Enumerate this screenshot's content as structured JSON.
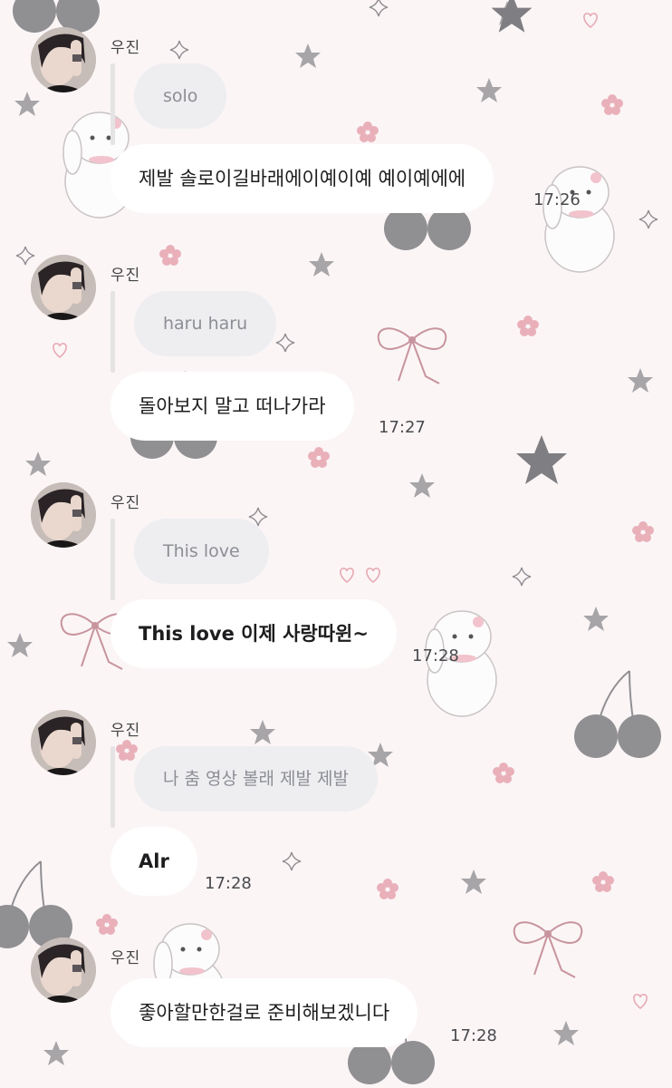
{
  "chat": {
    "messages": [
      {
        "sender": "우진",
        "quote": "solo",
        "text": "제발 솔로이길바래에이예이예 예이예에에",
        "time": "17:26"
      },
      {
        "sender": "우진",
        "quote": "haru haru",
        "text": "돌아보지 말고 떠나가라",
        "time": "17:27"
      },
      {
        "sender": "우진",
        "quote": "This love",
        "text": "This love 이제 사랑따윈~",
        "time": "17:28"
      },
      {
        "sender": "우진",
        "quote": "나 춤 영상 볼래 제발 제발",
        "text": "Alr",
        "time": "17:28"
      },
      {
        "sender": "우진",
        "text": "좋아할만한걸로 준비해보겠니다",
        "time": "17:28"
      }
    ]
  },
  "theme": {
    "wallpaper": "#fbf5f6",
    "bubble": "#ffffff",
    "quote_bubble": "#eeeef1",
    "reply_bar": "#e6e3e5",
    "accent_pink": "#e7a9b4",
    "cherry_gray": "#7d7d80"
  },
  "icons": [
    "avatar",
    "star-icon",
    "heart-icon",
    "flower-icon",
    "bunny-sticker",
    "cherry-sticker",
    "ribbon-bow-sticker",
    "sparkle-icon"
  ]
}
